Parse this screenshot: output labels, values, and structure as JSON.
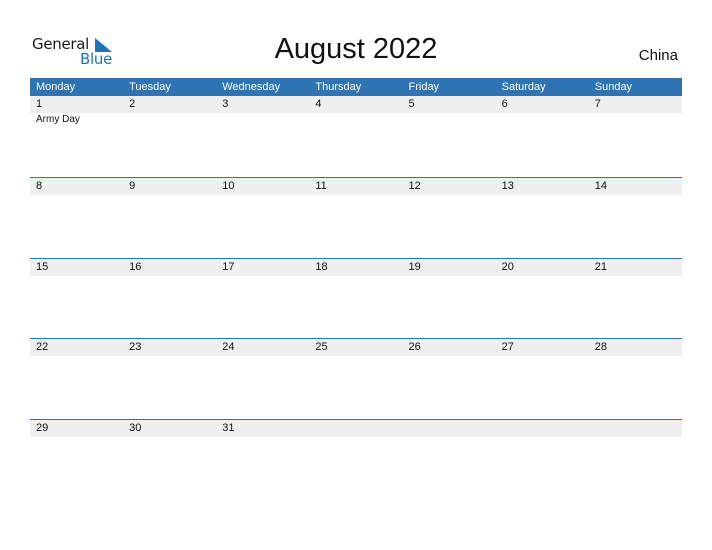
{
  "logo": {
    "part1": "General",
    "part2": "Blue",
    "icon": "flag-triangle-icon"
  },
  "header": {
    "title": "August 2022",
    "country": "China"
  },
  "colors": {
    "accent": "#2e74b5",
    "band": "#efefef",
    "logo_blue": "#1e74bd"
  },
  "weekdays": [
    "Monday",
    "Tuesday",
    "Wednesday",
    "Thursday",
    "Friday",
    "Saturday",
    "Sunday"
  ],
  "weeks": [
    {
      "days": [
        "1",
        "2",
        "3",
        "4",
        "5",
        "6",
        "7"
      ],
      "events": [
        "Army Day",
        "",
        "",
        "",
        "",
        "",
        ""
      ]
    },
    {
      "days": [
        "8",
        "9",
        "10",
        "11",
        "12",
        "13",
        "14"
      ],
      "events": [
        "",
        "",
        "",
        "",
        "",
        "",
        ""
      ]
    },
    {
      "days": [
        "15",
        "16",
        "17",
        "18",
        "19",
        "20",
        "21"
      ],
      "events": [
        "",
        "",
        "",
        "",
        "",
        "",
        ""
      ]
    },
    {
      "days": [
        "22",
        "23",
        "24",
        "25",
        "26",
        "27",
        "28"
      ],
      "events": [
        "",
        "",
        "",
        "",
        "",
        "",
        ""
      ]
    },
    {
      "days": [
        "29",
        "30",
        "31",
        "",
        "",
        "",
        ""
      ],
      "events": [
        "",
        "",
        "",
        "",
        "",
        "",
        ""
      ]
    }
  ]
}
